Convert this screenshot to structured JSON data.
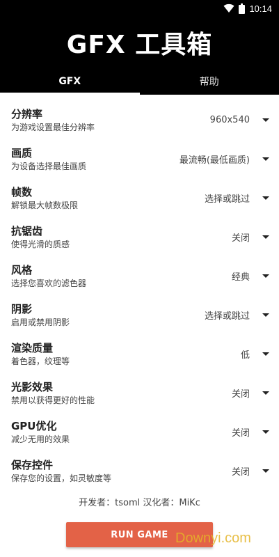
{
  "status_bar": {
    "time": "10:14"
  },
  "app": {
    "title": "GFX 工具箱"
  },
  "tabs": [
    {
      "label": "GFX"
    },
    {
      "label": "帮助"
    }
  ],
  "settings": [
    {
      "title": "分辨率",
      "subtitle": "为游戏设置最佳分辨率",
      "value": "960x540"
    },
    {
      "title": "画质",
      "subtitle": "为设备选择最佳画质",
      "value": "最流畅(最低画质)"
    },
    {
      "title": "帧数",
      "subtitle": "解锁最大帧数极限",
      "value": "选择或跳过"
    },
    {
      "title": "抗锯齿",
      "subtitle": "使得光滑的质感",
      "value": "关闭"
    },
    {
      "title": "风格",
      "subtitle": "选择您喜欢的滤色器",
      "value": "经典"
    },
    {
      "title": "阴影",
      "subtitle": "启用或禁用阴影",
      "value": "选择或跳过"
    },
    {
      "title": "渲染质量",
      "subtitle": "着色器，纹理等",
      "value": "低"
    },
    {
      "title": "光影效果",
      "subtitle": "禁用以获得更好的性能",
      "value": "关闭"
    },
    {
      "title": "GPU优化",
      "subtitle": "减少无用的效果",
      "value": "关闭"
    },
    {
      "title": "保存控件",
      "subtitle": "保存您的设置，如灵敏度等",
      "value": "关闭"
    }
  ],
  "credits": "开发者：tsoml   汉化者：MiKc",
  "run_button": {
    "label": "RUN GAME"
  },
  "watermark": "Downyi.com"
}
